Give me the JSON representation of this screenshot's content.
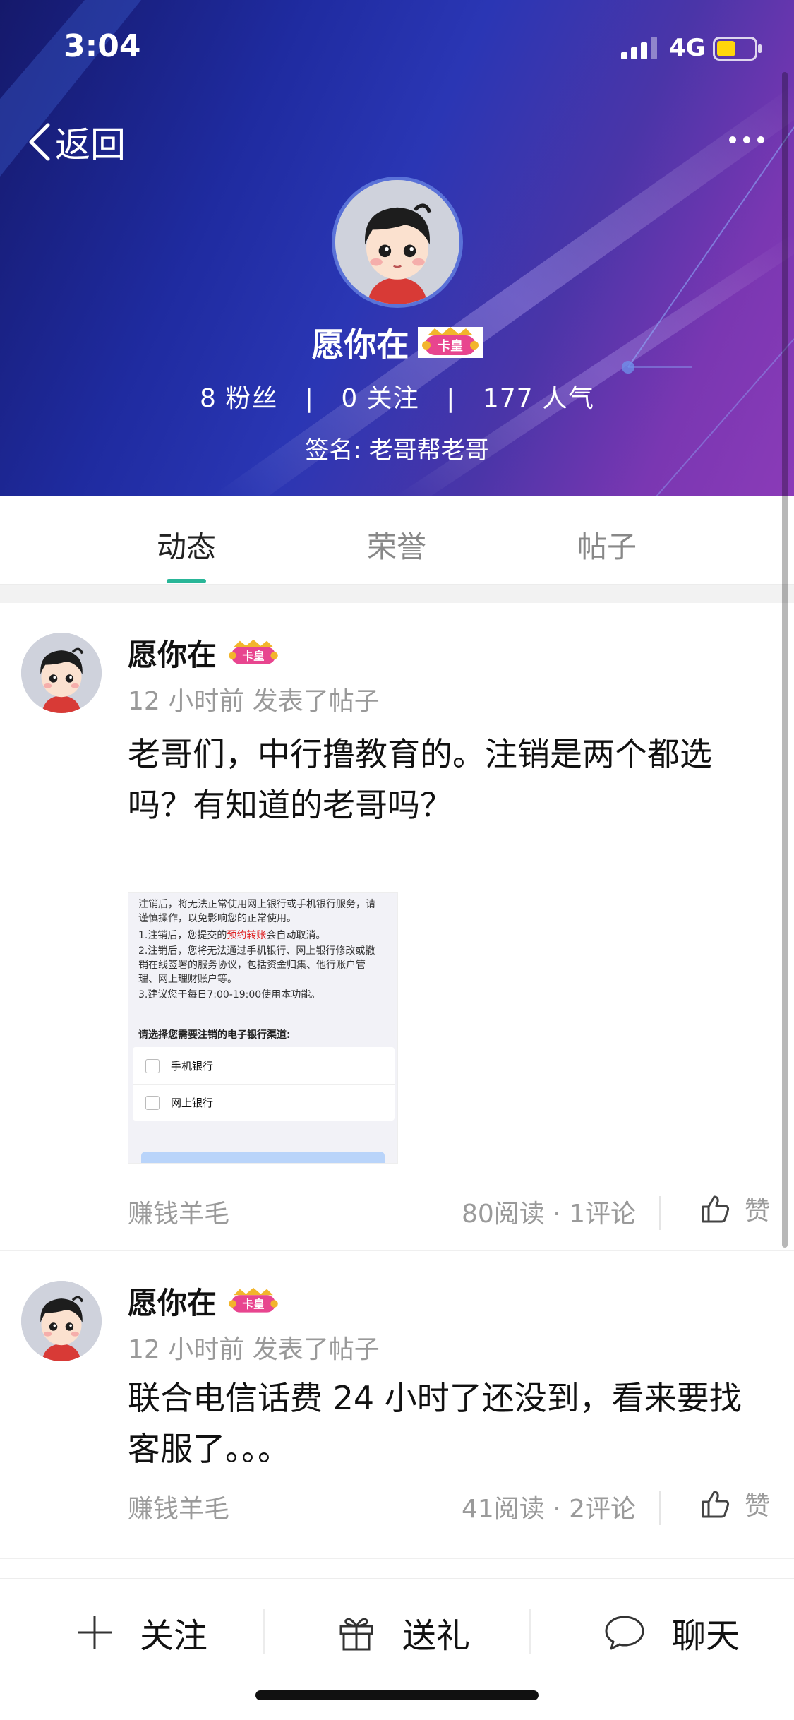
{
  "status_bar": {
    "time": "3:04",
    "network": "4G",
    "signal_bars": 3,
    "battery_level": 0.5
  },
  "nav": {
    "back_label": "返回",
    "more_icon": "more-dots-icon"
  },
  "profile": {
    "name": "愿你在",
    "badge_text": "卡皇",
    "fans_count": "8",
    "fans_label": "粉丝",
    "following_count": "0",
    "following_label": "关注",
    "popularity_count": "177",
    "popularity_label": "人气",
    "separator": "|",
    "signature": "签名: 老哥帮老哥"
  },
  "tabs": [
    {
      "label": "动态",
      "active": true
    },
    {
      "label": "荣誉",
      "active": false
    },
    {
      "label": "帖子",
      "active": false
    }
  ],
  "posts": [
    {
      "author": "愿你在",
      "badge_text": "卡皇",
      "meta": "12 小时前 发表了帖子",
      "text": "老哥们，中行撸教育的。注销是两个都选吗？有知道的老哥吗？",
      "image": {
        "lines": [
          "注销后，将无法正常使用网上银行或手机银行服务，请",
          "谨慎操作，以免影响您的正常使用。",
          "1.注销后，您提交的",
          "2.注销后，您将无法通过手机银行、网上银行修改或撤",
          "销在线签署的服务协议，包括资金归集、他行账户管",
          "理、网上理财账户等。",
          "3.建议您于每日7:00-19:00使用本功能。"
        ],
        "line3_highlight": "预约转账",
        "line3_suffix": "会自动取消。",
        "subtitle": "请选择您需要注销的电子银行渠道:",
        "options": [
          "手机银行",
          "网上银行"
        ]
      },
      "tag": "赚钱羊毛",
      "stats": "80阅读 · 1评论",
      "like_label": "赞"
    },
    {
      "author": "愿你在",
      "badge_text": "卡皇",
      "meta": "12 小时前 发表了帖子",
      "text": "联合电信话费 24 小时了还没到，看来要找客服了。。。",
      "tag": "赚钱羊毛",
      "stats": "41阅读 · 2评论",
      "like_label": "赞"
    }
  ],
  "bottom_bar": {
    "follow_label": "关注",
    "gift_label": "送礼",
    "chat_label": "聊天"
  },
  "colors": {
    "accent_green": "#29b698",
    "header_blue": "#2a36b4",
    "header_purple": "#8b3bb8",
    "badge_pink": "#e8458f"
  }
}
